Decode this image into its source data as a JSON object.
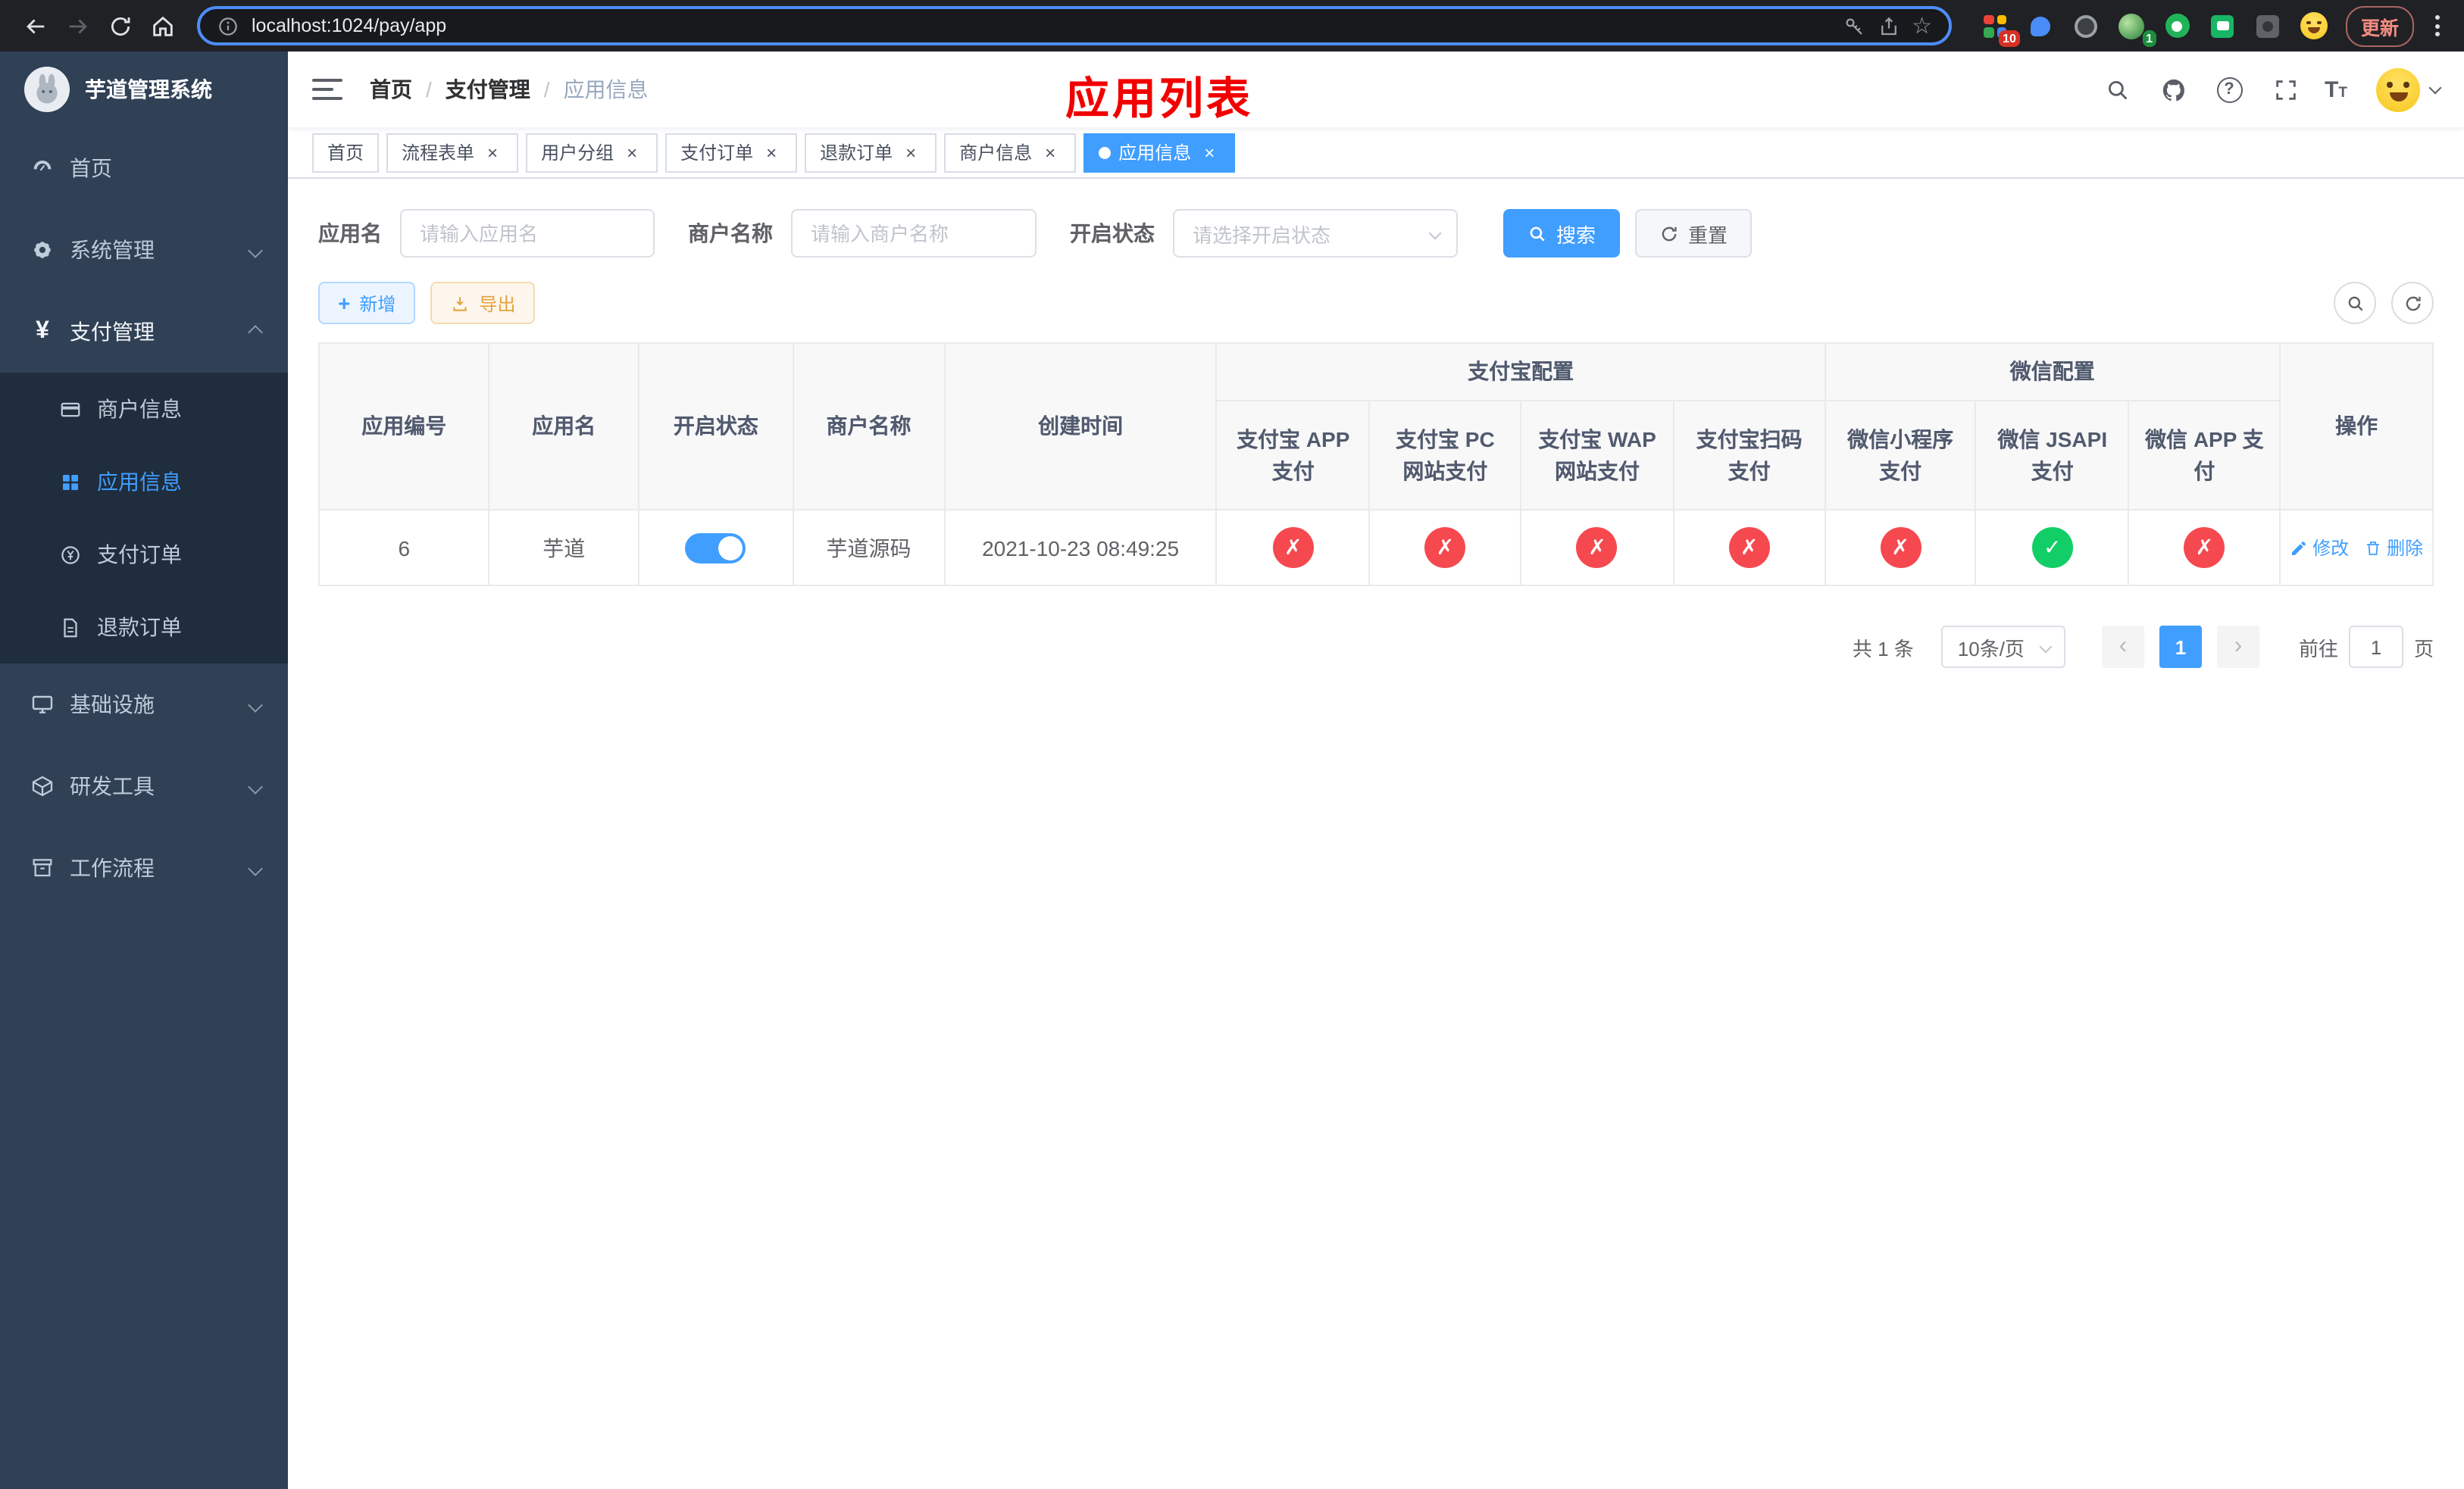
{
  "browser": {
    "url": "localhost:1024/pay/app",
    "update_label": "更新",
    "ext_badge_grid": "10",
    "ext_badge_avatar": "1"
  },
  "icons": {
    "close": "×",
    "breadcrumb_sep": "/",
    "star": "☆",
    "yen": "¥",
    "plus": "+",
    "question": "?",
    "font_size_big": "T",
    "font_size_small": "T"
  },
  "sidebar": {
    "logo_title": "芋道管理系统",
    "items": [
      {
        "label": "首页"
      },
      {
        "label": "系统管理"
      },
      {
        "label": "支付管理",
        "children": [
          {
            "label": "商户信息"
          },
          {
            "label": "应用信息"
          },
          {
            "label": "支付订单"
          },
          {
            "label": "退款订单"
          }
        ]
      },
      {
        "label": "基础设施"
      },
      {
        "label": "研发工具"
      },
      {
        "label": "工作流程"
      }
    ]
  },
  "header": {
    "breadcrumb": [
      "首页",
      "支付管理",
      "应用信息"
    ],
    "overlay_title": "应用列表"
  },
  "tabs": [
    {
      "label": "首页"
    },
    {
      "label": "流程表单"
    },
    {
      "label": "用户分组"
    },
    {
      "label": "支付订单"
    },
    {
      "label": "退款订单"
    },
    {
      "label": "商户信息"
    },
    {
      "label": "应用信息"
    }
  ],
  "filters": {
    "app_name_label": "应用名",
    "app_name_placeholder": "请输入应用名",
    "merchant_label": "商户名称",
    "merchant_placeholder": "请输入商户名称",
    "status_label": "开启状态",
    "status_placeholder": "请选择开启状态",
    "search_label": "搜索",
    "reset_label": "重置"
  },
  "toolbar": {
    "add_label": "新增",
    "export_label": "导出"
  },
  "table": {
    "group_headers": {
      "alipay": "支付宝配置",
      "wechat": "微信配置"
    },
    "columns": {
      "app_id": "应用编号",
      "app_name": "应用名",
      "status": "开启状态",
      "merchant": "商户名称",
      "created": "创建时间",
      "alipay_app": "支付宝 APP 支付",
      "alipay_pc": "支付宝 PC 网站支付",
      "alipay_wap": "支付宝 WAP 网站支付",
      "alipay_qr": "支付宝扫码支付",
      "wx_mini": "微信小程序支付",
      "wx_jsapi": "微信 JSAPI 支付",
      "wx_app": "微信 APP 支付",
      "actions": "操作"
    },
    "rows": [
      {
        "app_id": "6",
        "app_name": "芋道",
        "enabled": "on",
        "merchant": "芋道源码",
        "created": "2021-10-23 08:49:25",
        "statuses": {
          "alipay_app": {
            "state": "fail",
            "glyph": "✗"
          },
          "alipay_pc": {
            "state": "fail",
            "glyph": "✗"
          },
          "alipay_wap": {
            "state": "fail",
            "glyph": "✗"
          },
          "alipay_qr": {
            "state": "fail",
            "glyph": "✗"
          },
          "wx_mini": {
            "state": "fail",
            "glyph": "✗"
          },
          "wx_jsapi": {
            "state": "ok",
            "glyph": "✓"
          },
          "wx_app": {
            "state": "fail",
            "glyph": "✗"
          }
        },
        "edit_label": "修改",
        "delete_label": "删除"
      }
    ]
  },
  "pagination": {
    "total": "共 1 条",
    "page_size": "10条/页",
    "prev": "‹",
    "next": "›",
    "page": "1",
    "goto_label": "前往",
    "goto_value": "1",
    "unit_label": "页"
  },
  "colors": {
    "primary": "#409eff",
    "danger": "#f5494f",
    "success": "#12ce66",
    "warning": "#e6a23c",
    "sidebar_bg": "#304156",
    "submenu_bg": "#1f2d3d",
    "overlay_title": "#f20000"
  }
}
